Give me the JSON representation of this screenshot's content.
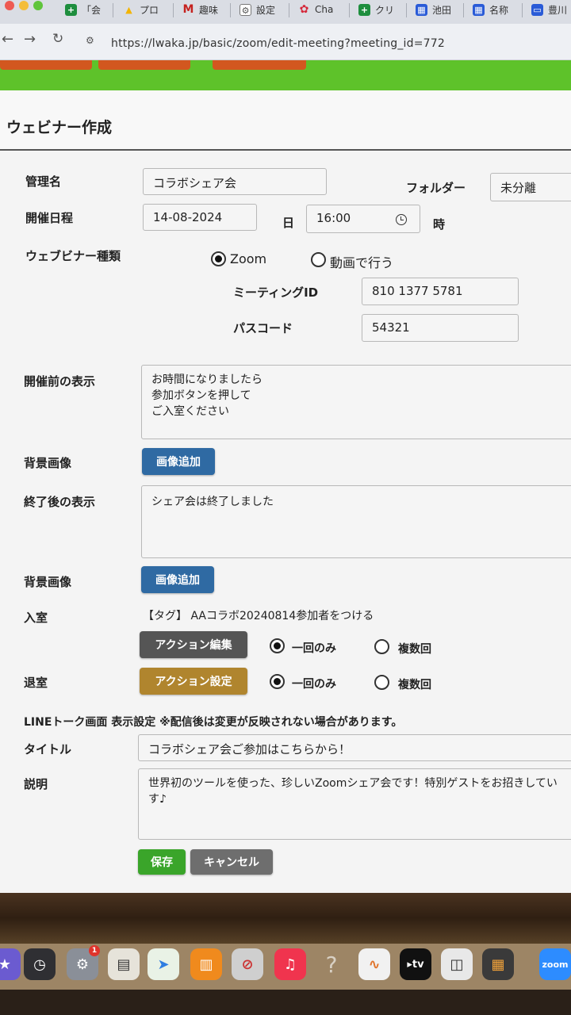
{
  "browser": {
    "tabs": [
      {
        "label": "「会",
        "icon": "sheets-icon"
      },
      {
        "label": "プロ",
        "icon": "drive-icon"
      },
      {
        "label": "趣味",
        "icon": "gmail-icon"
      },
      {
        "label": "設定",
        "icon": "settings-icon"
      },
      {
        "label": "Cha",
        "icon": "chatwork-icon"
      },
      {
        "label": "クリ",
        "icon": "sheets-icon"
      },
      {
        "label": "池田",
        "icon": "calendar-icon"
      },
      {
        "label": "名称",
        "icon": "calendar-icon"
      },
      {
        "label": "豊川",
        "icon": "print-icon"
      }
    ],
    "url": "https://lwaka.jp/basic/zoom/edit-meeting?meeting_id=772"
  },
  "page": {
    "title": "ウェビナー作成",
    "labels": {
      "manage_name": "管理名",
      "folder": "フォルダー",
      "date": "開催日程",
      "day_suffix": "日",
      "hour_suffix": "時",
      "webinar_type": "ウェブビナー種類",
      "meeting_id": "ミーティングID",
      "passcode": "パスコード",
      "before_display": "開催前の表示",
      "bg_image_1": "背景画像",
      "after_display": "終了後の表示",
      "bg_image_2": "背景画像",
      "enter": "入室",
      "exit": "退室",
      "line_setting": "LINEトーク画面 表示設定 ※配信後は変更が反映されない場合があります。",
      "line_title": "タイトル",
      "line_desc": "説明"
    },
    "values": {
      "manage_name": "コラボシェア会",
      "folder": "未分離",
      "date": "14-08-2024",
      "time": "16:00",
      "meeting_id": "810 1377 5781",
      "passcode": "54321",
      "before_display": "お時間になりましたら\n参加ボタンを押して\nご入室ください",
      "after_display": "シェア会は終了しました",
      "enter_tag": "【タグ】 AAコラボ20240814参加者をつける",
      "line_title": "コラボシェア会ご参加はこちらから！",
      "line_desc": "世界初のツールを使った、珍しいZoomシェア会です！特別ゲストをお招きしてい\nす♪"
    },
    "radios": {
      "type_zoom": "Zoom",
      "type_video": "動画で行う",
      "enter_once": "一回のみ",
      "enter_multi": "複数回",
      "exit_once": "一回のみ",
      "exit_multi": "複数回"
    },
    "buttons": {
      "add_image_1": "画像追加",
      "add_image_2": "画像追加",
      "action_edit": "アクション編集",
      "action_set": "アクション設定",
      "save": "保存",
      "cancel": "キャンセル"
    }
  },
  "dock": {
    "badge_count": "1",
    "zoom_label": "zoom",
    "tv_label": "tv",
    "help_glyph": "?"
  },
  "colors": {
    "green_header": "#5ec22a",
    "btn_blue": "#2f6aa3",
    "btn_gray": "#555555",
    "btn_gold": "#b0852e",
    "btn_save": "#3aa52a",
    "btn_cancel": "#6e6e6e"
  }
}
